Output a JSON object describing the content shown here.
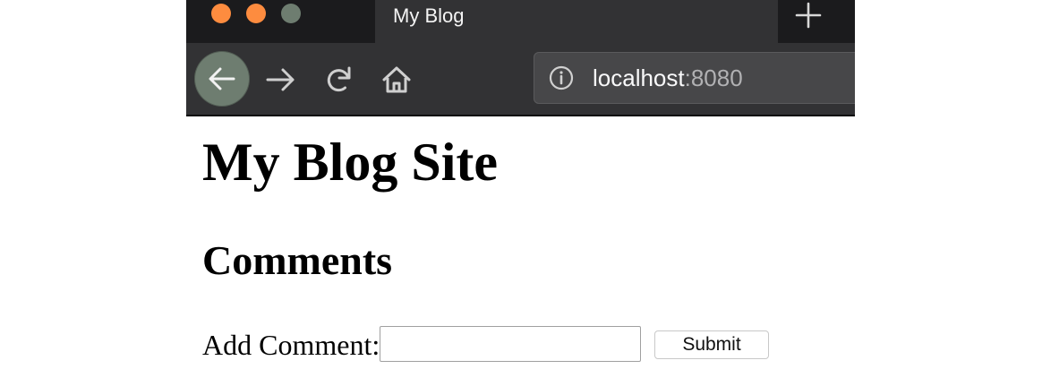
{
  "browser": {
    "tab": {
      "title": "My Blog"
    },
    "address_bar": {
      "host": "localhost",
      "port": ":8080"
    },
    "icons": {
      "close_window": "close-window-dot",
      "minimize_window": "minimize-window-dot",
      "maximize_window": "maximize-window-dot",
      "tab_close": "close-icon",
      "new_tab": "plus-icon",
      "back": "arrow-left-icon",
      "forward": "arrow-right-icon",
      "reload": "reload-icon",
      "home": "home-icon",
      "site_info": "info-icon"
    },
    "colors": {
      "traffic_close": "#fd8c3f",
      "traffic_minimize": "#fd8c3f",
      "traffic_maximize": "#6e7d70",
      "toolbar": "#323234",
      "tabstrip": "#1b1b1d",
      "back_button_active": "#6e7d70"
    }
  },
  "page": {
    "title": "My Blog Site",
    "comments_heading": "Comments",
    "comment_form": {
      "label": "Add Comment:",
      "input_value": "",
      "submit_label": "Submit"
    }
  }
}
